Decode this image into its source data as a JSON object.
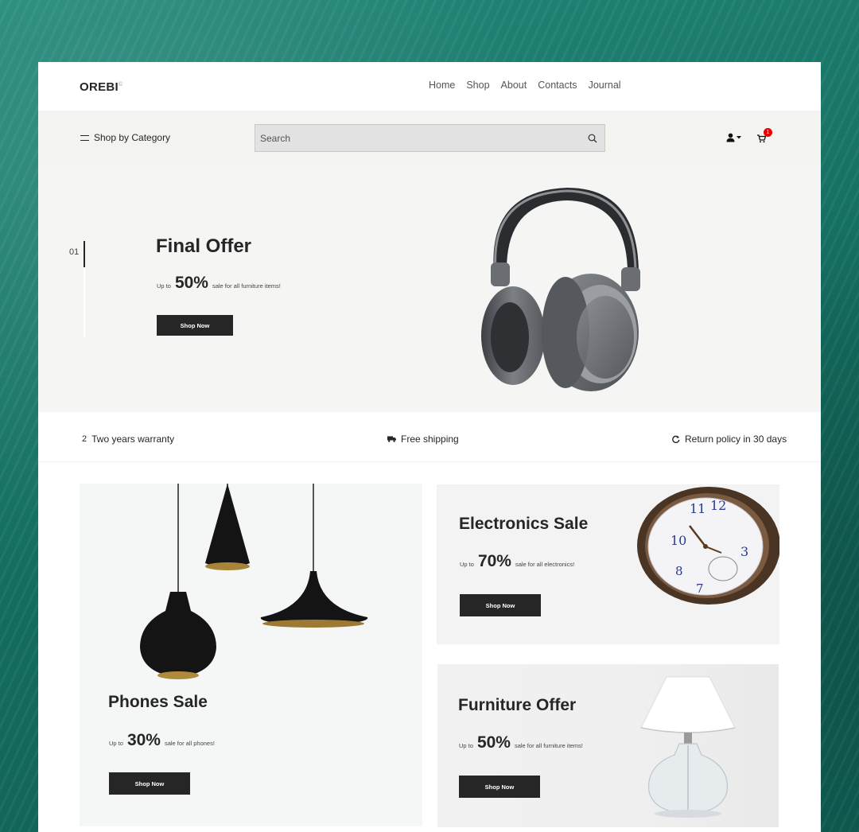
{
  "header": {
    "logo": "OREBI",
    "logo_mark": "©",
    "nav": [
      "Home",
      "Shop",
      "About",
      "Contacts",
      "Journal"
    ]
  },
  "category_bar": {
    "category_button": "Shop by Category",
    "search_placeholder": "Search",
    "cart_count": "1",
    "icons": [
      "menu-icon",
      "search-icon",
      "user-icon",
      "caret-down-icon",
      "cart-icon"
    ]
  },
  "hero": {
    "slide_number": "01",
    "title": "Final Offer",
    "promo_prefix": "Up to",
    "promo_value": "50%",
    "promo_suffix": "sale for all furniture items!",
    "button": "Shop Now"
  },
  "features": {
    "warranty_icon": "2",
    "warranty": "Two years warranty",
    "shipping": "Free shipping",
    "returns": "Return policy in 30 days",
    "icons": [
      "truck-icon",
      "refresh-icon"
    ]
  },
  "cards": {
    "phones": {
      "title": "Phones Sale",
      "promo_prefix": "Up to",
      "promo_value": "30%",
      "promo_suffix": "sale for all phones!",
      "button": "Shop Now"
    },
    "electronics": {
      "title": "Electronics Sale",
      "promo_prefix": "Up to",
      "promo_value": "70%",
      "promo_suffix": "sale for all electronics!",
      "button": "Shop Now"
    },
    "furniture": {
      "title": "Furniture Offer",
      "promo_prefix": "Up to",
      "promo_value": "50%",
      "promo_suffix": "sale for all furniture items!",
      "button": "Shop Now"
    }
  },
  "colors": {
    "background": "#1d7a6c",
    "dark": "#262626",
    "badge": "#e60000"
  }
}
